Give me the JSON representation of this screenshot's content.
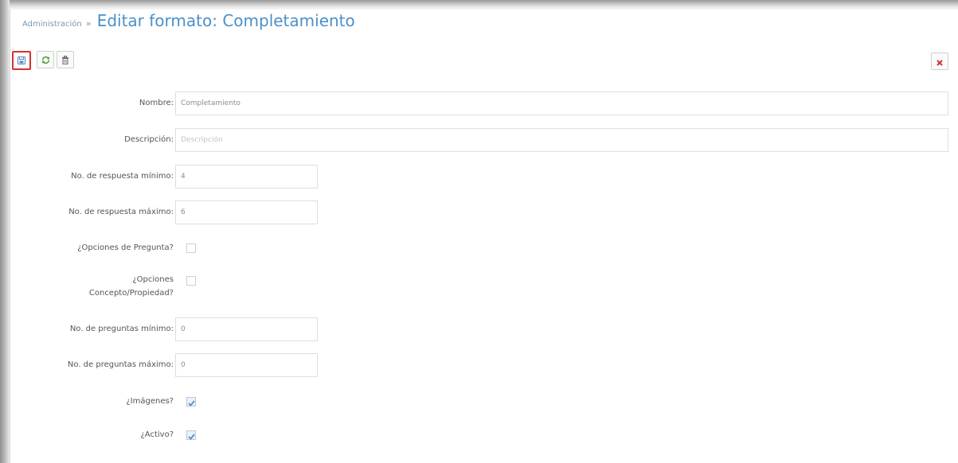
{
  "header": {
    "breadcrumb_parent": "Administración",
    "breadcrumb_separator": "»",
    "title": "Editar formato: Completamiento"
  },
  "toolbar": {
    "buttons": [
      {
        "name": "save",
        "icon": "save-icon"
      },
      {
        "name": "refresh",
        "icon": "refresh-icon"
      },
      {
        "name": "delete",
        "icon": "trash-icon"
      }
    ],
    "close_icon": "close-icon"
  },
  "form": {
    "nombre": {
      "label": "Nombre:",
      "value": "Completamiento"
    },
    "descripcion": {
      "label": "Descripción:",
      "value": "",
      "placeholder": "Descripción"
    },
    "respuesta_min": {
      "label": "No. de respuesta mínimo:",
      "value": "4"
    },
    "respuesta_max": {
      "label": "No. de respuesta máximo:",
      "value": "6"
    },
    "opciones_pregunta": {
      "label": "¿Opciones de Pregunta?",
      "checked": false
    },
    "opciones_concepto": {
      "label_line1": "¿Opciones",
      "label_line2": "Concepto/Propiedad?",
      "checked": false
    },
    "preguntas_min": {
      "label": "No. de preguntas mínimo:",
      "value": "0"
    },
    "preguntas_max": {
      "label": "No. de preguntas máximo:",
      "value": "0"
    },
    "imagenes": {
      "label": "¿Imágenes?",
      "checked": true
    },
    "activo": {
      "label": "¿Activo?",
      "checked": true
    }
  },
  "colors": {
    "title": "#4a90c8",
    "breadcrumb": "#7e97b2",
    "save_highlight": "#d43232",
    "close_icon": "#d43232",
    "checkbox_check": "#5b8bc4"
  }
}
